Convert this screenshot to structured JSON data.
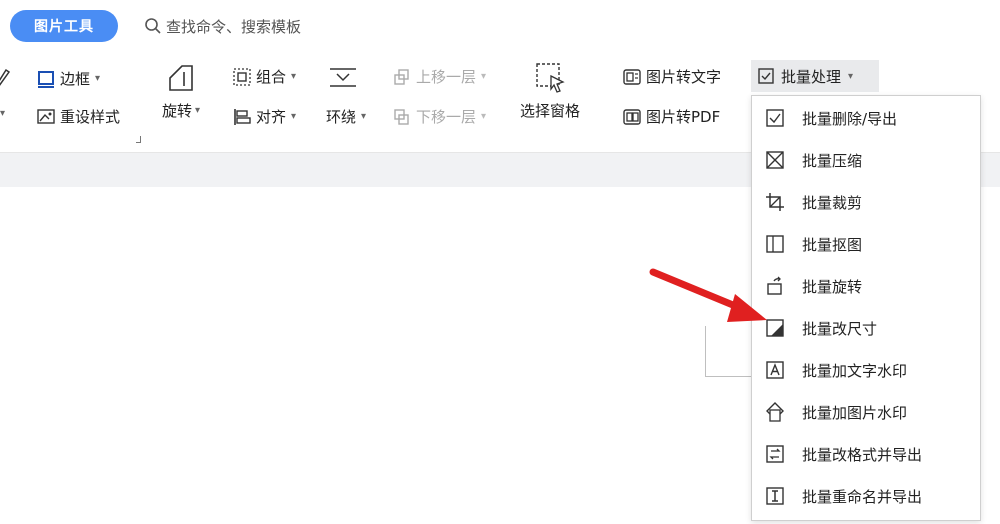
{
  "tabbar": {
    "tool_tab": "图片工具",
    "search_text": "查找命令、搜索模板"
  },
  "ribbon": {
    "border_label": "边框",
    "reset_style_label": "重设样式",
    "rotate_label": "旋转",
    "group_label": "组合",
    "align_label": "对齐",
    "wrap_label": "环绕",
    "bring_forward_label": "上移一层",
    "send_backward_label": "下移一层",
    "selection_pane_label": "选择窗格",
    "image_to_text_label": "图片转文字",
    "image_to_pdf_label": "图片转PDF",
    "batch_label": "批量处理"
  },
  "batch_menu": {
    "items": [
      {
        "label": "批量删除/导出",
        "icon": "checkbox-icon"
      },
      {
        "label": "批量压缩",
        "icon": "compress-icon"
      },
      {
        "label": "批量裁剪",
        "icon": "crop-icon"
      },
      {
        "label": "批量抠图",
        "icon": "cutout-icon"
      },
      {
        "label": "批量旋转",
        "icon": "rotate-icon"
      },
      {
        "label": "批量改尺寸",
        "icon": "resize-icon"
      },
      {
        "label": "批量加文字水印",
        "icon": "text-watermark-icon"
      },
      {
        "label": "批量加图片水印",
        "icon": "image-watermark-icon"
      },
      {
        "label": "批量改格式并导出",
        "icon": "format-export-icon"
      },
      {
        "label": "批量重命名并导出",
        "icon": "rename-export-icon"
      }
    ]
  },
  "colors": {
    "accent": "#4a8df4",
    "arrow": "#e02020",
    "band": "#f1f2f4",
    "menu_hover": "#e9eaec"
  }
}
